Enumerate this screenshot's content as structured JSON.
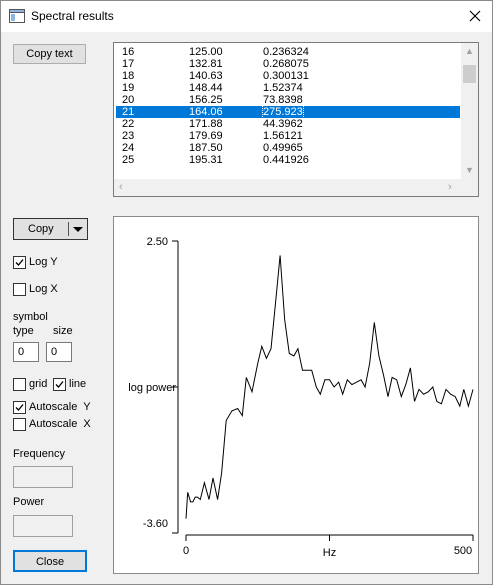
{
  "window": {
    "title": "Spectral results"
  },
  "buttons": {
    "copy_text": "Copy text",
    "copy": "Copy",
    "close": "Close"
  },
  "table": {
    "rows": [
      [
        "16",
        "125.00",
        "0.236324"
      ],
      [
        "17",
        "132.81",
        "0.268075"
      ],
      [
        "18",
        "140.63",
        "0.300131"
      ],
      [
        "19",
        "148.44",
        "1.52374"
      ],
      [
        "20",
        "156.25",
        "73.8398"
      ],
      [
        "21",
        "164.06",
        "275.923"
      ],
      [
        "22",
        "171.88",
        "44.3962"
      ],
      [
        "23",
        "179.69",
        "1.56121"
      ],
      [
        "24",
        "187.50",
        "0.49965"
      ],
      [
        "25",
        "195.31",
        "0.441926"
      ]
    ],
    "selected_index": 5
  },
  "controls": {
    "log_y": {
      "label": "Log Y",
      "checked": true
    },
    "log_x": {
      "label": "Log X",
      "checked": false
    },
    "symbol": {
      "label": "symbol",
      "type_label": "type",
      "size_label": "size",
      "type_value": "0",
      "size_value": "0"
    },
    "grid": {
      "label": "grid",
      "checked": false
    },
    "line": {
      "label": "line",
      "checked": true
    },
    "autoscale_y": {
      "label": "Autoscale  Y",
      "checked": true
    },
    "autoscale_x": {
      "label": "Autoscale  X",
      "checked": false
    },
    "frequency_label": "Frequency",
    "power_label": "Power"
  },
  "chart_data": {
    "type": "line",
    "ylabel": "log power",
    "xlabel": "Hz",
    "ylim": [
      -3.6,
      2.5
    ],
    "xlim": [
      0,
      500
    ],
    "y_tick_labels": [
      "2.50",
      "-3.60"
    ],
    "x_tick_labels": [
      "0",
      "Hz",
      "500"
    ],
    "grid": false,
    "series": [
      {
        "x": [
          0,
          3,
          8,
          12,
          16,
          20,
          25,
          32,
          40,
          47,
          55,
          62,
          70,
          80,
          90,
          98,
          105,
          115,
          125,
          132,
          140,
          148,
          156,
          164,
          172,
          180,
          188,
          195,
          203,
          211,
          219,
          227,
          234,
          242,
          250,
          258,
          266,
          273,
          281,
          289,
          297,
          305,
          312,
          320,
          328,
          336,
          344,
          352,
          359,
          367,
          375,
          383,
          391,
          398,
          406,
          414,
          422,
          430,
          437,
          445,
          453,
          461,
          469,
          477,
          484,
          492,
          500
        ],
        "y": [
          -3.3,
          -2.75,
          -2.95,
          -2.95,
          -2.85,
          -2.85,
          -2.9,
          -2.55,
          -2.9,
          -2.45,
          -2.9,
          -2.35,
          -1.25,
          -1.05,
          -1.0,
          -1.15,
          -0.35,
          -0.65,
          -0.05,
          0.3,
          0.05,
          0.25,
          1.2,
          2.2,
          0.85,
          0.15,
          0.1,
          0.25,
          -0.2,
          -0.2,
          -0.2,
          -0.55,
          -0.7,
          -0.4,
          -0.4,
          -0.55,
          -0.45,
          -0.7,
          -0.4,
          -0.5,
          -0.45,
          -0.4,
          -0.55,
          -0.05,
          0.8,
          0.1,
          -0.3,
          -0.75,
          -0.35,
          -0.4,
          -0.75,
          -0.5,
          -0.15,
          -0.85,
          -0.6,
          -0.7,
          -0.65,
          -0.55,
          -0.85,
          -0.9,
          -0.6,
          -0.7,
          -0.75,
          -0.95,
          -0.6,
          -0.95,
          -0.6
        ]
      }
    ]
  }
}
